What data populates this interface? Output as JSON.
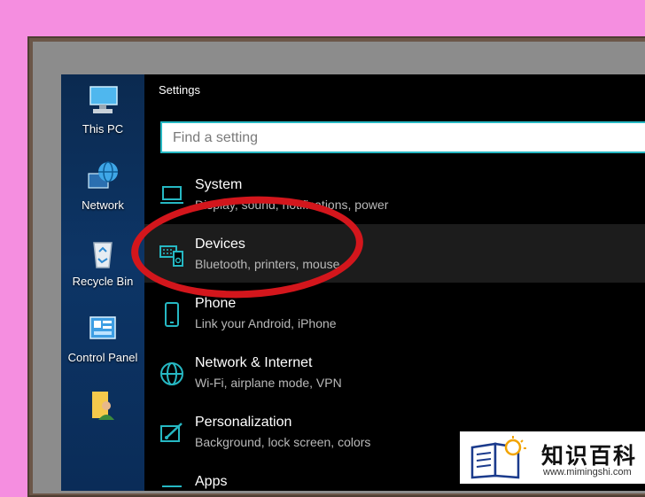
{
  "desktop": {
    "icons": [
      {
        "label": "This PC",
        "icon": "computer-icon"
      },
      {
        "label": "Network",
        "icon": "network-globe-icon"
      },
      {
        "label": "Recycle Bin",
        "icon": "recycle-bin-icon"
      },
      {
        "label": "Control Panel",
        "icon": "control-panel-icon"
      },
      {
        "label": "",
        "icon": "user-folder-icon"
      }
    ]
  },
  "settings": {
    "title": "Settings",
    "search_placeholder": "Find a setting",
    "categories": [
      {
        "title": "System",
        "subtitle": "Display, sound, notifications, power",
        "icon": "laptop-icon"
      },
      {
        "title": "Devices",
        "subtitle": "Bluetooth, printers, mouse",
        "icon": "keyboard-speaker-icon",
        "highlighted": true
      },
      {
        "title": "Phone",
        "subtitle": "Link your Android, iPhone",
        "icon": "phone-icon"
      },
      {
        "title": "Network & Internet",
        "subtitle": "Wi-Fi, airplane mode, VPN",
        "icon": "globe-icon"
      },
      {
        "title": "Personalization",
        "subtitle": "Background, lock screen, colors",
        "icon": "paint-brush-icon"
      },
      {
        "title": "Apps",
        "subtitle": "",
        "icon": "apps-icon"
      }
    ]
  },
  "annotation": {
    "color": "#d3161c"
  },
  "watermark": {
    "text": "知识百科",
    "url": "www.mimingshi.com",
    "icon": "book-bulb-icon"
  },
  "colors": {
    "accent": "#26b8c3",
    "background": "#f58ee0"
  }
}
